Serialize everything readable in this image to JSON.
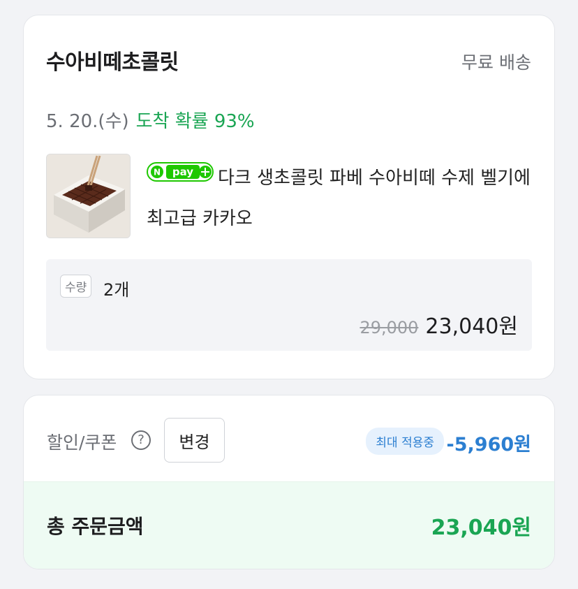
{
  "order": {
    "shop_name": "수아비떼초콜릿",
    "shipping": "무료 배송",
    "delivery_date": "5. 20.(수)",
    "arrival_probability": "도착 확률 93%",
    "product": {
      "title": "다크 생초콜릿 파베 수아비떼 수제 벨기에 최고급 카카오",
      "badge_text": "pay",
      "badge_icon": "npay-plus-icon"
    },
    "quantity_tag": "수량",
    "quantity": "2개",
    "original_price": "29,000",
    "sale_price": "23,040원"
  },
  "discount": {
    "label": "할인/쿠폰",
    "help": "?",
    "change_button": "변경",
    "max_badge": "최대 적용중",
    "amount": "-5,960원"
  },
  "total": {
    "label": "총 주문금액",
    "amount": "23,040원"
  },
  "colors": {
    "accent_green": "#1aa553",
    "accent_blue": "#2c7fd1",
    "badge_bg": "#e6f1fd",
    "total_bg": "#eefbf3"
  }
}
